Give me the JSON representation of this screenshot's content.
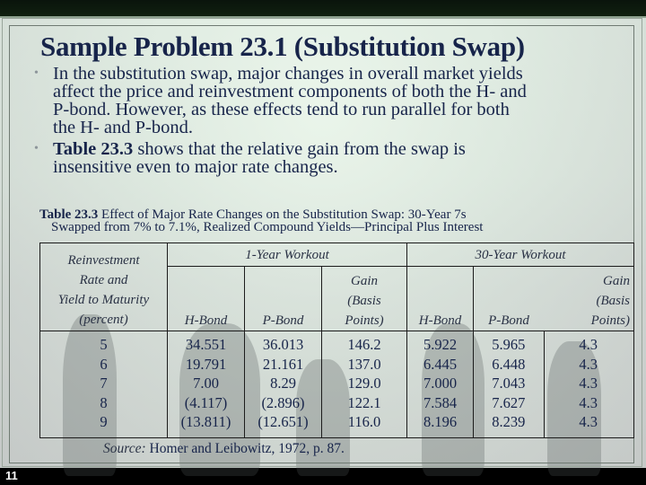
{
  "slide": {
    "title": "Sample Problem 23.1 (Substitution Swap)",
    "bullets": [
      {
        "bold_prefix": "",
        "lines": [
          "In the substitution swap, major changes in overall market yields",
          "affect the price and reinvestment components of both the H- and",
          "P-bond. However, as these effects tend to run parallel for both",
          "the H- and P-bond."
        ]
      },
      {
        "bold_prefix": "Table 23.3",
        "lines": [
          " shows that the relative gain from the swap is",
          "insensitive even to major rate changes."
        ]
      }
    ],
    "bullet_icon": "bullet-dot-icon",
    "page_number": "11"
  },
  "table": {
    "caption_bold": "Table 23.3",
    "caption_line1": " Effect of Major Rate Changes on the Substitution Swap: 30-Year 7s",
    "caption_line2": "Swapped from 7% to 7.1%, Realized Compound Yields—Principal Plus Interest",
    "group_headers": [
      "1-Year Workout",
      "30-Year Workout"
    ],
    "first_col_header": [
      "Reinvestment",
      "Rate and",
      "Yield to Maturity",
      "(percent)"
    ],
    "sub_headers": {
      "h_bond": "H-Bond",
      "p_bond": "P-Bond",
      "gain": [
        "Gain",
        "(Basis",
        "Points)"
      ]
    },
    "columns": {
      "rate": [
        "5",
        "6",
        "7",
        "8",
        "9"
      ],
      "y1_h_bond": [
        "34.551",
        "19.791",
        "7.00",
        "(4.117)",
        "(13.811)"
      ],
      "y1_p_bond": [
        "36.013",
        "21.161",
        "8.29",
        "(2.896)",
        "(12.651)"
      ],
      "y1_gain": [
        "146.2",
        "137.0",
        "129.0",
        "122.1",
        "116.0"
      ],
      "y30_h_bond": [
        "5.922",
        "6.445",
        "7.000",
        "7.584",
        "8.196"
      ],
      "y30_p_bond": [
        "5.965",
        "6.448",
        "7.043",
        "7.627",
        "8.239"
      ],
      "y30_gain": [
        "4.3",
        "4.3",
        "4.3",
        "4.3",
        "4.3"
      ]
    },
    "source_label": "Source:",
    "source_text": " Homer and Leibowitz, 1972, p. 87."
  }
}
